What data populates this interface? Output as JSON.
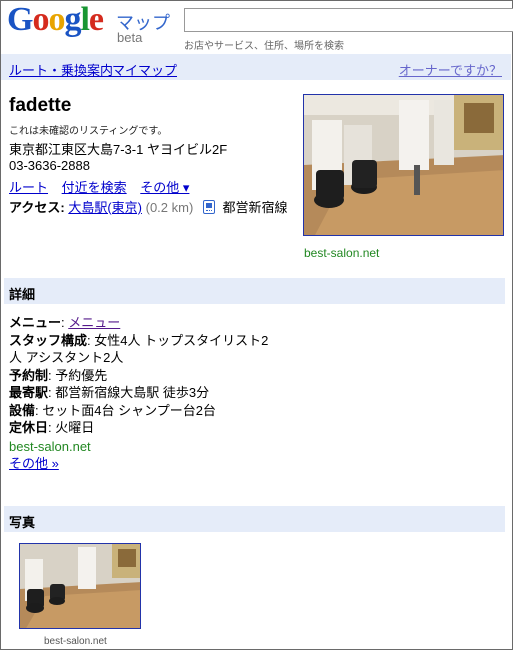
{
  "header": {
    "logo": {
      "G": "G",
      "o1": "o",
      "o2": "o",
      "g": "g",
      "l": "l",
      "e": "e"
    },
    "maps_label": "マップ",
    "beta_label": "beta",
    "search_value": "",
    "search_hint": "お店やサービス、住所、場所を検索"
  },
  "nav": {
    "route_link": "ルート・乗換案内",
    "mymap_link": "マイマップ",
    "owner_link": "オーナーですか？"
  },
  "listing": {
    "name": "fadette",
    "unconfirmed_note": "これは未確認のリスティングです。",
    "address": "東京都江東区大島7-3-1 ヤヨイビル2F",
    "phone": "03-3636-2888",
    "actions": {
      "route": "ルート",
      "nearby": "付近を検索",
      "more": "その他 ▾"
    },
    "access": {
      "label": "アクセス:",
      "station": "大島駅(東京)",
      "distance": "(0.2 km)",
      "line": "都営新宿線"
    },
    "photo_source": "best-salon.net"
  },
  "details_section": {
    "title": "詳細",
    "menu_key": "メニュー",
    "menu_link": "メニュー",
    "rows": [
      {
        "key": "スタッフ構成",
        "value": ": 女性4人 トップスタイリスト2人 アシスタント2人"
      },
      {
        "key": "予約制",
        "value": ": 予約優先"
      },
      {
        "key": "最寄駅",
        "value": ": 都営新宿線大島駅 徒歩3分"
      },
      {
        "key": "設備",
        "value": ": セット面4台 シャンプー台2台"
      },
      {
        "key": "定休日",
        "value": ": 火曜日"
      }
    ],
    "source": "best-salon.net",
    "more_link": "その他 »"
  },
  "photos_section": {
    "title": "写真",
    "thumb_caption": "best-salon.net"
  },
  "colors": {
    "link": "#0000cc",
    "source_green": "#228822",
    "section_bg": "#e5ecf9"
  }
}
